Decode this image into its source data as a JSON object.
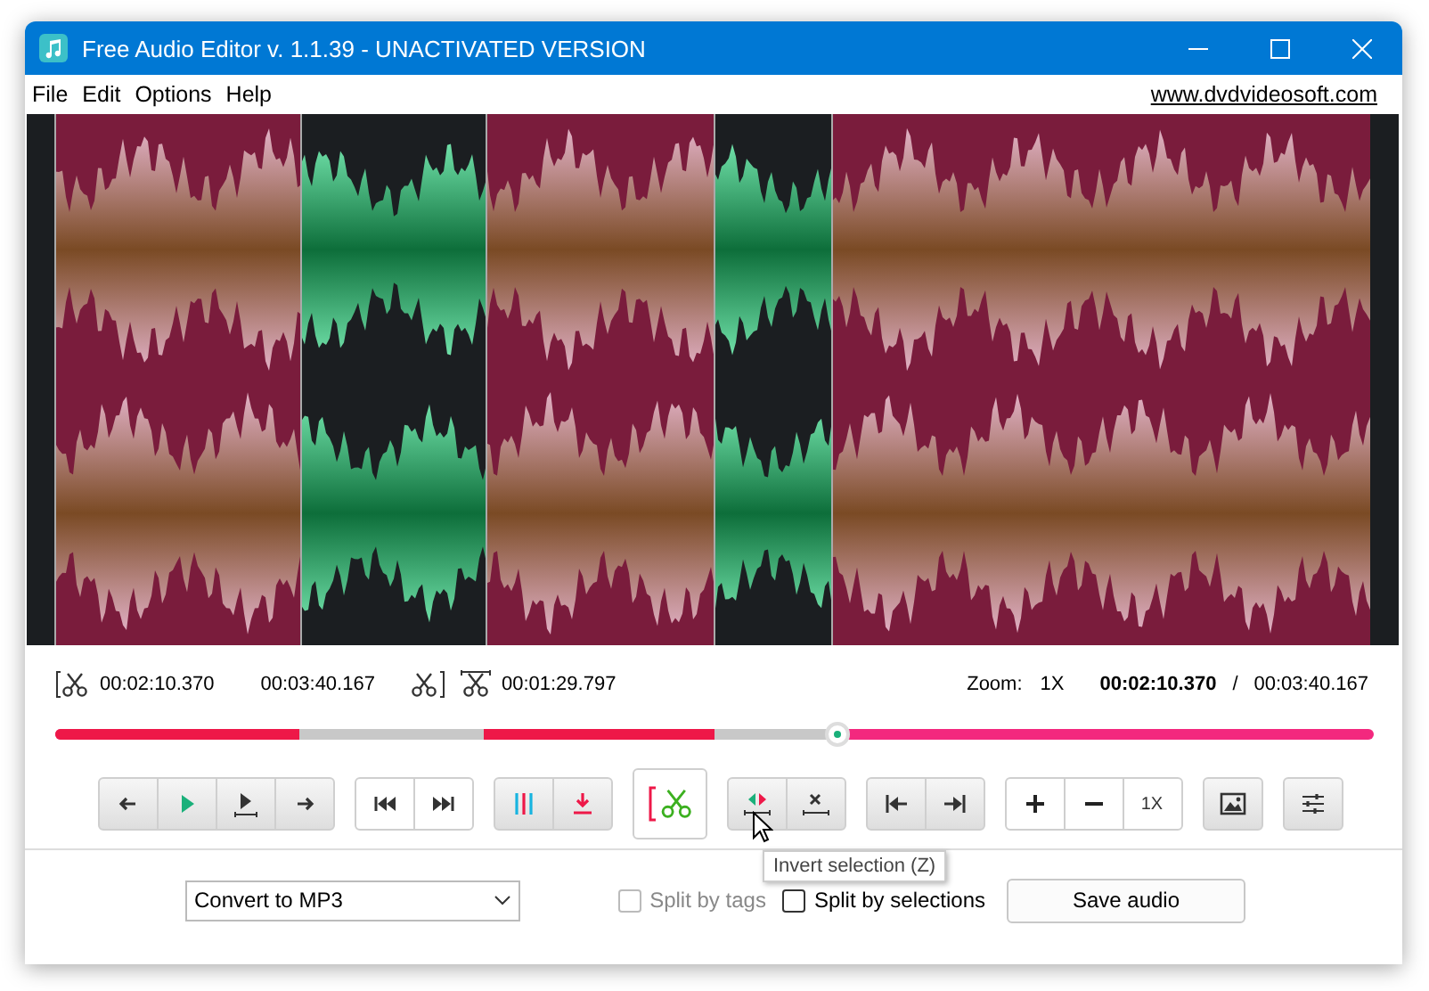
{
  "window": {
    "title": "Free Audio Editor v. 1.1.39 - UNACTIVATED VERSION"
  },
  "menu": [
    {
      "label": "File"
    },
    {
      "label": "Edit"
    },
    {
      "label": "Options"
    },
    {
      "label": "Help"
    }
  ],
  "link": "www.dvdvideosoft.com",
  "selection": {
    "start": "00:02:10.370",
    "end": "00:03:40.167",
    "length": "00:01:29.797"
  },
  "zoom": {
    "label": "Zoom:",
    "value": "1X"
  },
  "position": {
    "current": "00:02:10.370",
    "separator": "/",
    "total": "00:03:40.167"
  },
  "seek": {
    "level": 0.593
  },
  "toolbar": {
    "zoom_reset": "1X"
  },
  "tooltip": "Invert selection (Z)",
  "format": {
    "value": "Convert to MP3"
  },
  "options": [
    {
      "label": "Split by tags",
      "checked": false,
      "disabled": true
    },
    {
      "label": "Split by selections",
      "checked": false,
      "disabled": false
    }
  ],
  "save_button": "Save audio"
}
